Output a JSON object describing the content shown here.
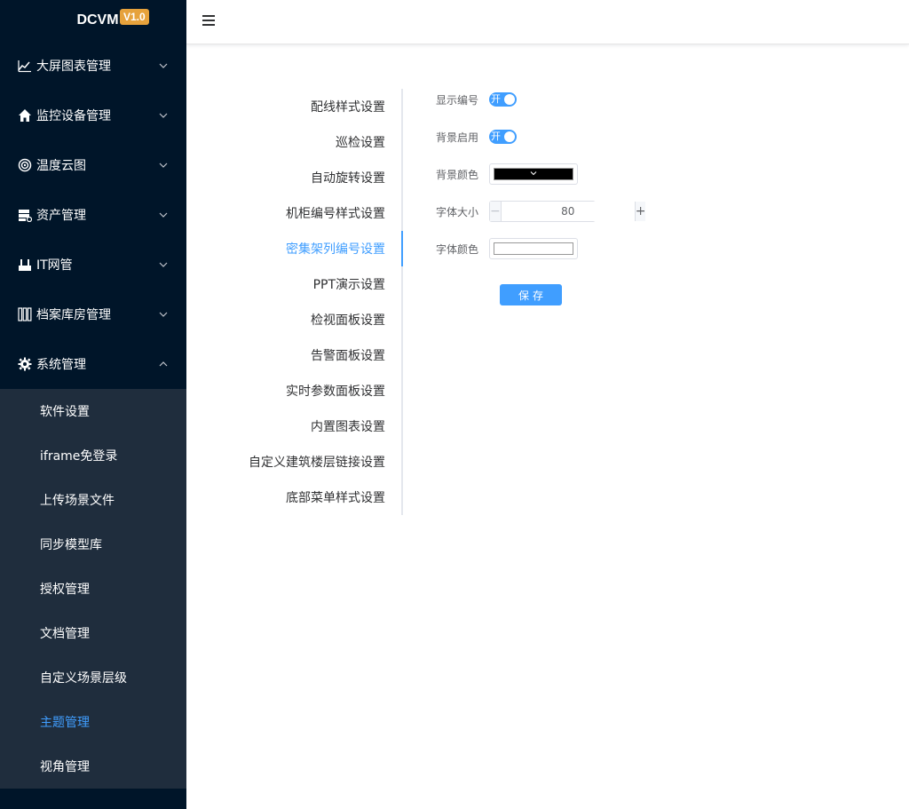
{
  "brand": {
    "title": "DCVM",
    "version": "V1.0"
  },
  "colors": {
    "sidebar_bg": "#001529",
    "submenu_bg": "#1f2d3d",
    "accent": "#409eff",
    "badge": "#e6a23c"
  },
  "sidebar": {
    "menus": [
      {
        "label": "大屏图表管理",
        "icon": "line-chart-icon"
      },
      {
        "label": "监控设备管理",
        "icon": "home-icon"
      },
      {
        "label": "温度云图",
        "icon": "target-icon"
      },
      {
        "label": "资产管理",
        "icon": "server-icon"
      },
      {
        "label": "IT网管",
        "icon": "router-icon"
      },
      {
        "label": "档案库房管理",
        "icon": "archive-shelf-icon"
      },
      {
        "label": "系统管理",
        "icon": "gear-icon",
        "expanded": true
      }
    ],
    "submenu": [
      {
        "label": "软件设置"
      },
      {
        "label": "iframe免登录"
      },
      {
        "label": "上传场景文件"
      },
      {
        "label": "同步模型库"
      },
      {
        "label": "授权管理"
      },
      {
        "label": "文档管理"
      },
      {
        "label": "自定义场景层级"
      },
      {
        "label": "主题管理",
        "active": true
      },
      {
        "label": "视角管理"
      }
    ]
  },
  "settings_nav": [
    "配线样式设置",
    "巡检设置",
    "自动旋转设置",
    "机柜编号样式设置",
    "密集架列编号设置",
    "PPT演示设置",
    "检视面板设置",
    "告警面板设置",
    "实时参数面板设置",
    "内置图表设置",
    "自定义建筑楼层链接设置",
    "底部菜单样式设置"
  ],
  "settings_nav_active": "密集架列编号设置",
  "form": {
    "show_number": {
      "label": "显示编号",
      "switch_text": "开",
      "on": true
    },
    "bg_enabled": {
      "label": "背景启用",
      "switch_text": "开",
      "on": true
    },
    "bg_color": {
      "label": "背景颜色",
      "value": "#000000"
    },
    "font_size": {
      "label": "字体大小",
      "value": "80",
      "minus": "−",
      "plus": "+"
    },
    "font_color": {
      "label": "字体颜色",
      "value": "#ffffff"
    },
    "save_label": "保存"
  }
}
